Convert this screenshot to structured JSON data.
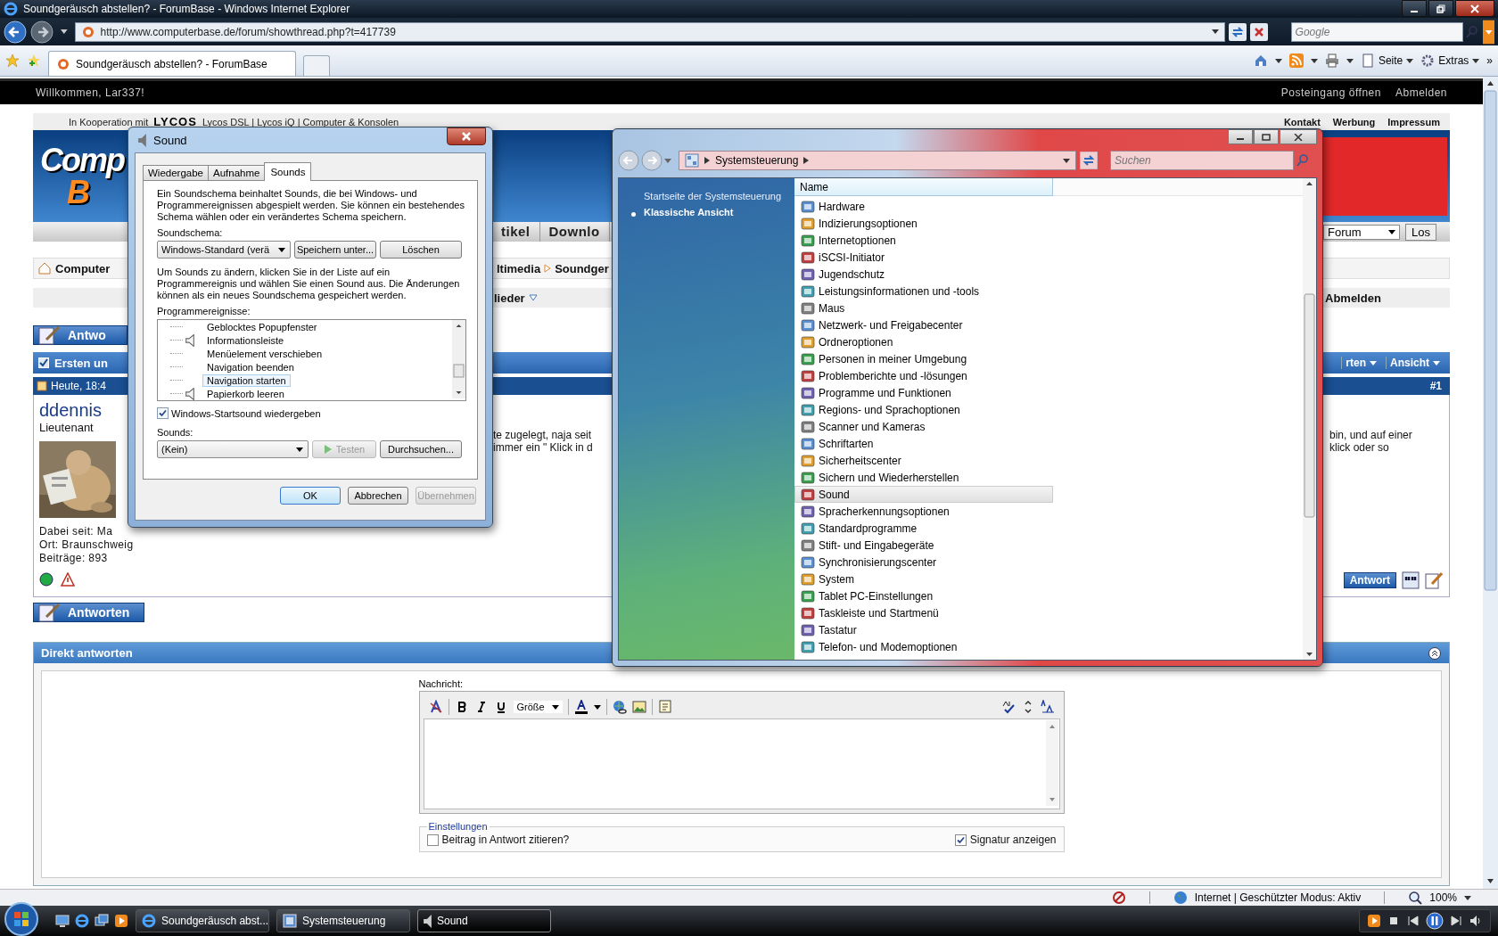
{
  "browser": {
    "title": "Soundgeräusch abstellen? - ForumBase - Windows Internet Explorer",
    "url": "http://www.computerbase.de/forum/showthread.php?t=417739",
    "search": {
      "placeholder": "Google"
    },
    "tabs": [
      {
        "label": "Soundgeräusch abstellen? - ForumBase",
        "selected": true
      }
    ],
    "commands": [
      "Seite",
      "Extras"
    ],
    "more": "»"
  },
  "forum": {
    "welcome": "Willkommen, Lar337!",
    "top_links": [
      "Posteingang öffnen",
      "Abmelden"
    ],
    "cooperation": {
      "label": "In Kooperation mit",
      "logo": "LYCOS",
      "links": "Lycos DSL | Lycos iQ | Computer & Konsolen"
    },
    "header_links": [
      "Kontakt",
      "Werbung",
      "Impressum"
    ],
    "logo": {
      "text": "Comp",
      "letter": "B"
    },
    "nav_tabs": [
      "tikel",
      "Downlo"
    ],
    "forum_select": "Forum",
    "go_button": "Los",
    "breadcrumb": {
      "home": "Computer",
      "path": "ltimedia",
      "current": "Soundger"
    },
    "members_menu": "lieder",
    "logout": "Abmelden",
    "reply_buttons": [
      "Antwo",
      "Antworten"
    ],
    "thread_bar": {
      "title": "Ersten un",
      "menus": [
        "rten",
        "Ansicht"
      ]
    },
    "post": {
      "date": "Heute, 18:4",
      "number": "#1",
      "author": "ddennis",
      "rank": "Lieutenant",
      "avatar": {
        "kind": "picture"
      },
      "info": [
        "Dabei seit: Ma",
        "Ort: Braunschweig",
        "Beiträge: 893"
      ],
      "online": true,
      "text_middle": [
        "te zugelegt, naja seit",
        "immer ein \" Klick in d"
      ],
      "text_right": [
        "bin, und auf einer",
        "klick oder so"
      ],
      "reply_button": "Antwort"
    },
    "quick_reply": {
      "title": "Direkt antworten",
      "label": "Nachricht:",
      "font_size": "Größe",
      "settings_title": "Einstellungen",
      "options": [
        {
          "label": "Beitrag in Antwort zitieren?",
          "checked": false
        },
        {
          "label": "Signatur anzeigen",
          "checked": true
        }
      ]
    }
  },
  "sound_dialog": {
    "title": "Sound",
    "tabs": [
      {
        "label": "Wiedergabe",
        "selected": false
      },
      {
        "label": "Aufnahme",
        "selected": false
      },
      {
        "label": "Sounds",
        "selected": true
      }
    ],
    "intro": "Ein Soundschema beinhaltet Sounds, die bei Windows- und Programmereignissen abgespielt werden. Sie können ein bestehendes Schema wählen oder ein verändertes Schema speichern.",
    "scheme_label": "Soundschema:",
    "scheme": "Windows-Standard (verä",
    "scheme_buttons": [
      "Speichern unter...",
      "Löschen"
    ],
    "hint": "Um Sounds zu ändern, klicken Sie in der Liste auf ein Programmereignis und wählen Sie einen Sound aus. Die Änderungen können als ein neues Soundschema gespeichert werden.",
    "events_label": "Programmereignisse:",
    "events": [
      {
        "label": "Geblocktes Popupfenster",
        "sound": false,
        "selected": false
      },
      {
        "label": "Informationsleiste",
        "sound": true,
        "selected": false
      },
      {
        "label": "Menüelement verschieben",
        "sound": false,
        "selected": false
      },
      {
        "label": "Navigation beenden",
        "sound": false,
        "selected": false
      },
      {
        "label": "Navigation starten",
        "sound": false,
        "selected": true
      },
      {
        "label": "Papierkorb leeren",
        "sound": true,
        "selected": false
      }
    ],
    "startup_sound": {
      "label": "Windows-Startsound wiedergeben",
      "checked": true
    },
    "sounds_label": "Sounds:",
    "sound": "(Kein)",
    "test_button": {
      "label": "Testen",
      "disabled": true
    },
    "browse_button": "Durchsuchen...",
    "buttons": [
      {
        "label": "OK",
        "disabled": false,
        "default": true
      },
      {
        "label": "Abbrechen",
        "disabled": false,
        "default": false
      },
      {
        "label": "Übernehmen",
        "disabled": true,
        "default": false
      }
    ]
  },
  "control_panel": {
    "address": "Systemsteuerung",
    "search": {
      "placeholder": "Suchen"
    },
    "tasks": [
      {
        "label": "Startseite der Systemsteuerung",
        "selected": false
      },
      {
        "label": "Klassische Ansicht",
        "selected": true
      }
    ],
    "column": "Name",
    "items": [
      {
        "label": "Hardware",
        "selected": false
      },
      {
        "label": "Indizierungsoptionen",
        "selected": false
      },
      {
        "label": "Internetoptionen",
        "selected": false
      },
      {
        "label": "iSCSI-Initiator",
        "selected": false
      },
      {
        "label": "Jugendschutz",
        "selected": false
      },
      {
        "label": "Leistungsinformationen und -tools",
        "selected": false
      },
      {
        "label": "Maus",
        "selected": false
      },
      {
        "label": "Netzwerk- und Freigabecenter",
        "selected": false
      },
      {
        "label": "Ordneroptionen",
        "selected": false
      },
      {
        "label": "Personen in meiner Umgebung",
        "selected": false
      },
      {
        "label": "Problemberichte und -lösungen",
        "selected": false
      },
      {
        "label": "Programme und Funktionen",
        "selected": false
      },
      {
        "label": "Regions- und Sprachoptionen",
        "selected": false
      },
      {
        "label": "Scanner und Kameras",
        "selected": false
      },
      {
        "label": "Schriftarten",
        "selected": false
      },
      {
        "label": "Sicherheitscenter",
        "selected": false
      },
      {
        "label": "Sichern und Wiederherstellen",
        "selected": false
      },
      {
        "label": "Sound",
        "selected": true
      },
      {
        "label": "Spracherkennungsoptionen",
        "selected": false
      },
      {
        "label": "Standardprogramme",
        "selected": false
      },
      {
        "label": "Stift- und Eingabegeräte",
        "selected": false
      },
      {
        "label": "Synchronisierungscenter",
        "selected": false
      },
      {
        "label": "System",
        "selected": false
      },
      {
        "label": "Tablet PC-Einstellungen",
        "selected": false
      },
      {
        "label": "Taskleiste und Startmenü",
        "selected": false
      },
      {
        "label": "Tastatur",
        "selected": false
      },
      {
        "label": "Telefon- und Modemoptionen",
        "selected": false
      }
    ]
  },
  "status_bar": {
    "zone": "Internet | Geschützter Modus: Aktiv",
    "zoom": "100%"
  },
  "taskbar": {
    "buttons": [
      {
        "label": "Soundgeräusch abst...",
        "selected": false
      },
      {
        "label": "Systemsteuerung",
        "selected": false
      },
      {
        "label": "Sound",
        "selected": true
      }
    ]
  }
}
